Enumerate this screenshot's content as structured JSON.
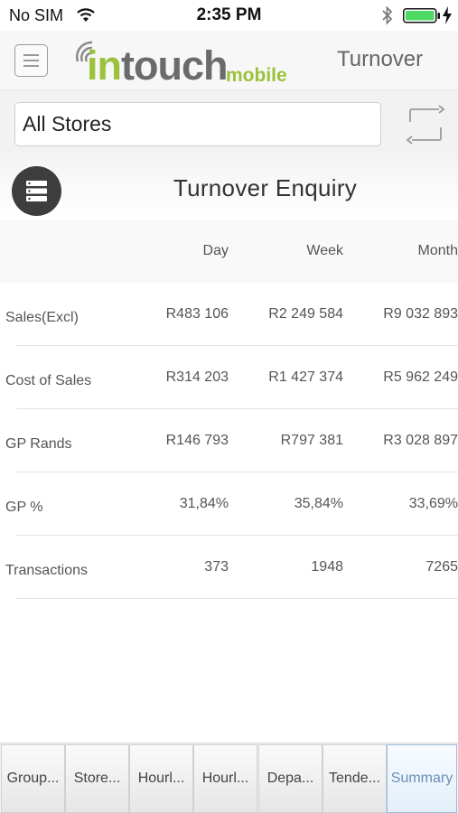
{
  "status_bar": {
    "carrier": "No SIM",
    "time": "2:35 PM"
  },
  "header": {
    "logo_in": "in",
    "logo_touch": "touch",
    "logo_mobile": "mobile",
    "title": "Turnover"
  },
  "store_selector": {
    "value": "All Stores"
  },
  "page": {
    "title": "Turnover Enquiry"
  },
  "table": {
    "columns": [
      "Day",
      "Week",
      "Month"
    ],
    "rows": [
      {
        "label": "Sales(Excl)",
        "day": "R483 106",
        "week": "R2 249 584",
        "month": "R9 032 893"
      },
      {
        "label": "Cost of Sales",
        "day": "R314 203",
        "week": "R1 427 374",
        "month": "R5 962 249"
      },
      {
        "label": "GP Rands",
        "day": "R146 793",
        "week": "R797 381",
        "month": "R3 028 897"
      },
      {
        "label": "GP %",
        "day": "31,84%",
        "week": "35,84%",
        "month": "33,69%"
      },
      {
        "label": "Transactions",
        "day": "373",
        "week": "1948",
        "month": "7265"
      }
    ]
  },
  "tabs": [
    {
      "label": "Group..."
    },
    {
      "label": "Store..."
    },
    {
      "label": "Hourl..."
    },
    {
      "label": "Hourl..."
    },
    {
      "label": "Depa..."
    },
    {
      "label": "Tende..."
    },
    {
      "label": "Summary",
      "active": true
    }
  ],
  "colors": {
    "brand_green": "#9bc23c",
    "brand_gray": "#6b6b6b",
    "battery_green": "#4cd964",
    "active_tab": "#6a8fb8"
  },
  "icons": [
    "wifi-icon",
    "bluetooth-icon",
    "battery-icon",
    "charging-icon",
    "menu-icon",
    "refresh-icon",
    "database-icon"
  ]
}
